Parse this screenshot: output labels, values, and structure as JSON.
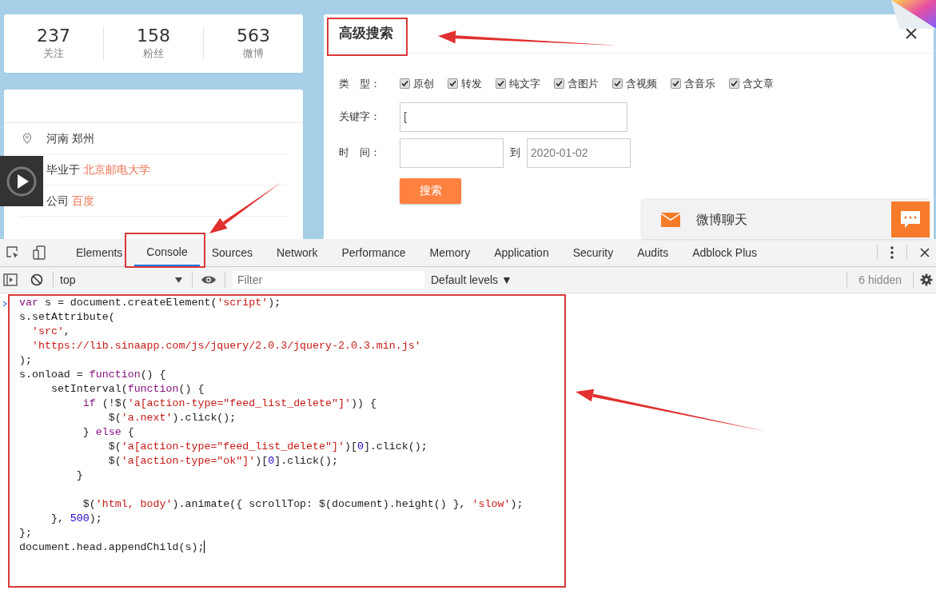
{
  "stats": [
    {
      "value": "237",
      "label": "关注"
    },
    {
      "value": "158",
      "label": "粉丝"
    },
    {
      "value": "563",
      "label": "微博"
    }
  ],
  "profile": {
    "items": [
      {
        "kind": "location",
        "text": "河南 郑州"
      },
      {
        "kind": "school",
        "prefix": "毕业于",
        "link": "北京邮电大学"
      },
      {
        "kind": "company",
        "prefix": "公司",
        "link": "百度"
      }
    ]
  },
  "search_panel": {
    "title": "高级搜索",
    "type_label": "类　型：",
    "types": [
      {
        "label": "原创",
        "checked": true
      },
      {
        "label": "转发",
        "checked": true
      },
      {
        "label": "纯文字",
        "checked": true
      },
      {
        "label": "含图片",
        "checked": true
      },
      {
        "label": "含视频",
        "checked": true
      },
      {
        "label": "含音乐",
        "checked": true
      },
      {
        "label": "含文章",
        "checked": true
      }
    ],
    "keyword_label": "关键字：",
    "keyword_value": "[",
    "time_label": "时　间：",
    "to_label": "到",
    "time_to": "2020-01-02",
    "button": "搜索"
  },
  "chat_widget": {
    "title": "微博聊天"
  },
  "devtools": {
    "tabs": [
      {
        "label": "Elements",
        "selected": false
      },
      {
        "label": "Console",
        "selected": true
      },
      {
        "label": "Sources",
        "selected": false
      },
      {
        "label": "Network",
        "selected": false
      },
      {
        "label": "Performance",
        "selected": false
      },
      {
        "label": "Memory",
        "selected": false
      },
      {
        "label": "Application",
        "selected": false
      },
      {
        "label": "Security",
        "selected": false
      },
      {
        "label": "Audits",
        "selected": false
      },
      {
        "label": "Adblock Plus",
        "selected": false
      }
    ],
    "context": "top",
    "filter_placeholder": "Filter",
    "levels": "Default levels ▼",
    "hidden_count": "6 hidden",
    "code_lines": [
      {
        "tokens": [
          {
            "kind": "keyword",
            "text": "var"
          },
          {
            "kind": "plain",
            "text": " s = document.createElement("
          },
          {
            "kind": "string",
            "text": "'script'"
          },
          {
            "kind": "plain",
            "text": ");"
          }
        ]
      },
      {
        "tokens": [
          {
            "kind": "plain",
            "text": "s.setAttribute("
          }
        ]
      },
      {
        "tokens": [
          {
            "kind": "string",
            "text": "  'src'"
          },
          {
            "kind": "plain",
            "text": ","
          }
        ]
      },
      {
        "tokens": [
          {
            "kind": "string",
            "text": "  'https://lib.sinaapp.com/js/jquery/2.0.3/jquery-2.0.3.min.js'"
          }
        ]
      },
      {
        "tokens": [
          {
            "kind": "plain",
            "text": ");"
          }
        ]
      },
      {
        "tokens": [
          {
            "kind": "plain",
            "text": "s.onload = "
          },
          {
            "kind": "keyword",
            "text": "function"
          },
          {
            "kind": "plain",
            "text": "() {"
          }
        ]
      },
      {
        "tokens": [
          {
            "kind": "plain",
            "text": "     setInterval("
          },
          {
            "kind": "keyword",
            "text": "function"
          },
          {
            "kind": "plain",
            "text": "() {"
          }
        ]
      },
      {
        "tokens": [
          {
            "kind": "keyword",
            "text": "          if"
          },
          {
            "kind": "plain",
            "text": " (!$("
          },
          {
            "kind": "string",
            "text": "'a[action-type=\"feed_list_delete\"]'"
          },
          {
            "kind": "plain",
            "text": ")) {"
          }
        ]
      },
      {
        "tokens": [
          {
            "kind": "plain",
            "text": "              $("
          },
          {
            "kind": "string",
            "text": "'a.next'"
          },
          {
            "kind": "plain",
            "text": ").click();"
          }
        ]
      },
      {
        "tokens": [
          {
            "kind": "plain",
            "text": "          } "
          },
          {
            "kind": "keyword",
            "text": "else"
          },
          {
            "kind": "plain",
            "text": " {"
          }
        ]
      },
      {
        "tokens": [
          {
            "kind": "plain",
            "text": "              $("
          },
          {
            "kind": "string",
            "text": "'a[action-type=\"feed_list_delete\"]'"
          },
          {
            "kind": "plain",
            "text": ")["
          },
          {
            "kind": "number",
            "text": "0"
          },
          {
            "kind": "plain",
            "text": "].click();"
          }
        ]
      },
      {
        "tokens": [
          {
            "kind": "plain",
            "text": "              $("
          },
          {
            "kind": "string",
            "text": "'a[action-type=\"ok\"]'"
          },
          {
            "kind": "plain",
            "text": ")["
          },
          {
            "kind": "number",
            "text": "0"
          },
          {
            "kind": "plain",
            "text": "].click();"
          }
        ]
      },
      {
        "tokens": [
          {
            "kind": "plain",
            "text": "         }"
          }
        ]
      },
      {
        "kind": "blank"
      },
      {
        "tokens": [
          {
            "kind": "plain",
            "text": "          $("
          },
          {
            "kind": "string",
            "text": "'html, body'"
          },
          {
            "kind": "plain",
            "text": ").animate({ scrollTop: $(document).height() }, "
          },
          {
            "kind": "string",
            "text": "'slow'"
          },
          {
            "kind": "plain",
            "text": ");"
          }
        ]
      },
      {
        "tokens": [
          {
            "kind": "plain",
            "text": "     }, "
          },
          {
            "kind": "number",
            "text": "500"
          },
          {
            "kind": "plain",
            "text": ");"
          }
        ]
      },
      {
        "tokens": [
          {
            "kind": "plain",
            "text": "};"
          }
        ]
      },
      {
        "tokens": [
          {
            "kind": "plain",
            "text": "document.head.appendChild(s);"
          }
        ]
      }
    ]
  }
}
